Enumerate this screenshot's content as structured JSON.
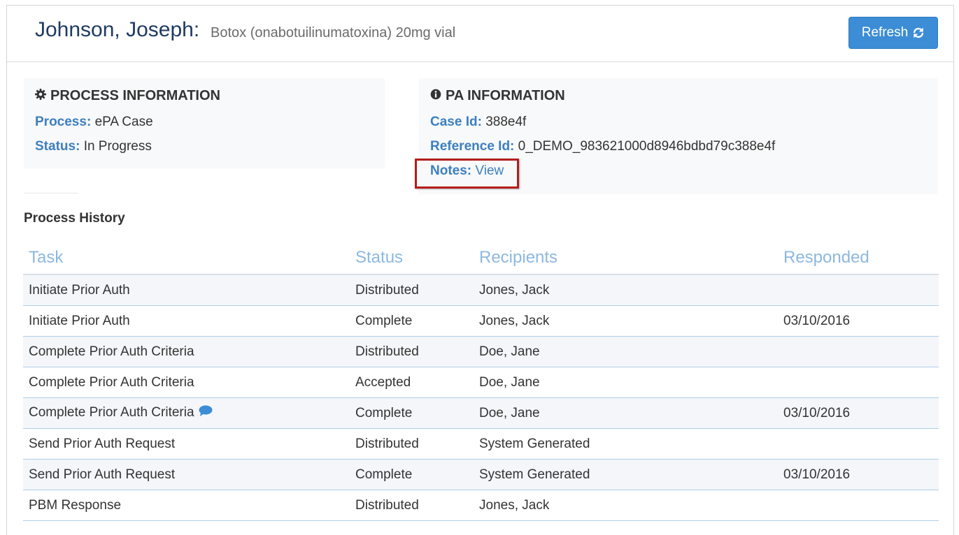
{
  "header": {
    "patient_name": "Johnson, Joseph:",
    "drug": "Botox (onabotuilinumatoxina) 20mg vial",
    "refresh_label": "Refresh"
  },
  "process_info": {
    "title": "PROCESS INFORMATION",
    "process_label": "Process:",
    "process_value": "ePA Case",
    "status_label": "Status:",
    "status_value": "In Progress"
  },
  "pa_info": {
    "title": "PA INFORMATION",
    "case_id_label": "Case Id:",
    "case_id_value": "388e4f",
    "reference_id_label": "Reference Id:",
    "reference_id_value": "0_DEMO_983621000d8946bdbd79c388e4f",
    "notes_label": "Notes:",
    "notes_link": "View"
  },
  "history": {
    "title": "Process History",
    "columns": [
      "Task",
      "Status",
      "Recipients",
      "Responded"
    ],
    "rows": [
      {
        "task": "Initiate Prior Auth",
        "status": "Distributed",
        "recipients": "Jones, Jack",
        "responded": ""
      },
      {
        "task": "Initiate Prior Auth",
        "status": "Complete",
        "recipients": "Jones, Jack",
        "responded": "03/10/2016"
      },
      {
        "task": "Complete Prior Auth Criteria",
        "status": "Distributed",
        "recipients": "Doe, Jane",
        "responded": ""
      },
      {
        "task": "Complete Prior Auth Criteria",
        "status": "Accepted",
        "recipients": "Doe, Jane",
        "responded": ""
      },
      {
        "task": "Complete Prior Auth Criteria",
        "status": "Complete",
        "recipients": "Doe, Jane",
        "responded": "03/10/2016",
        "has_comment": true
      },
      {
        "task": "Send Prior Auth Request",
        "status": "Distributed",
        "recipients": "System Generated",
        "responded": ""
      },
      {
        "task": "Send Prior Auth Request",
        "status": "Complete",
        "recipients": "System Generated",
        "responded": "03/10/2016"
      },
      {
        "task": "PBM Response",
        "status": "Distributed",
        "recipients": "Jones, Jack",
        "responded": ""
      }
    ]
  },
  "icons": {
    "process": "gear-icon",
    "pa": "info-circle-icon",
    "refresh": "refresh-icon",
    "comment": "chat-bubble-icon"
  },
  "colors": {
    "primary": "#3c8dd5",
    "label": "#3c7fc0",
    "title": "#1f3b63",
    "highlight": "#b51c1c",
    "column_header": "#8db8e0"
  }
}
